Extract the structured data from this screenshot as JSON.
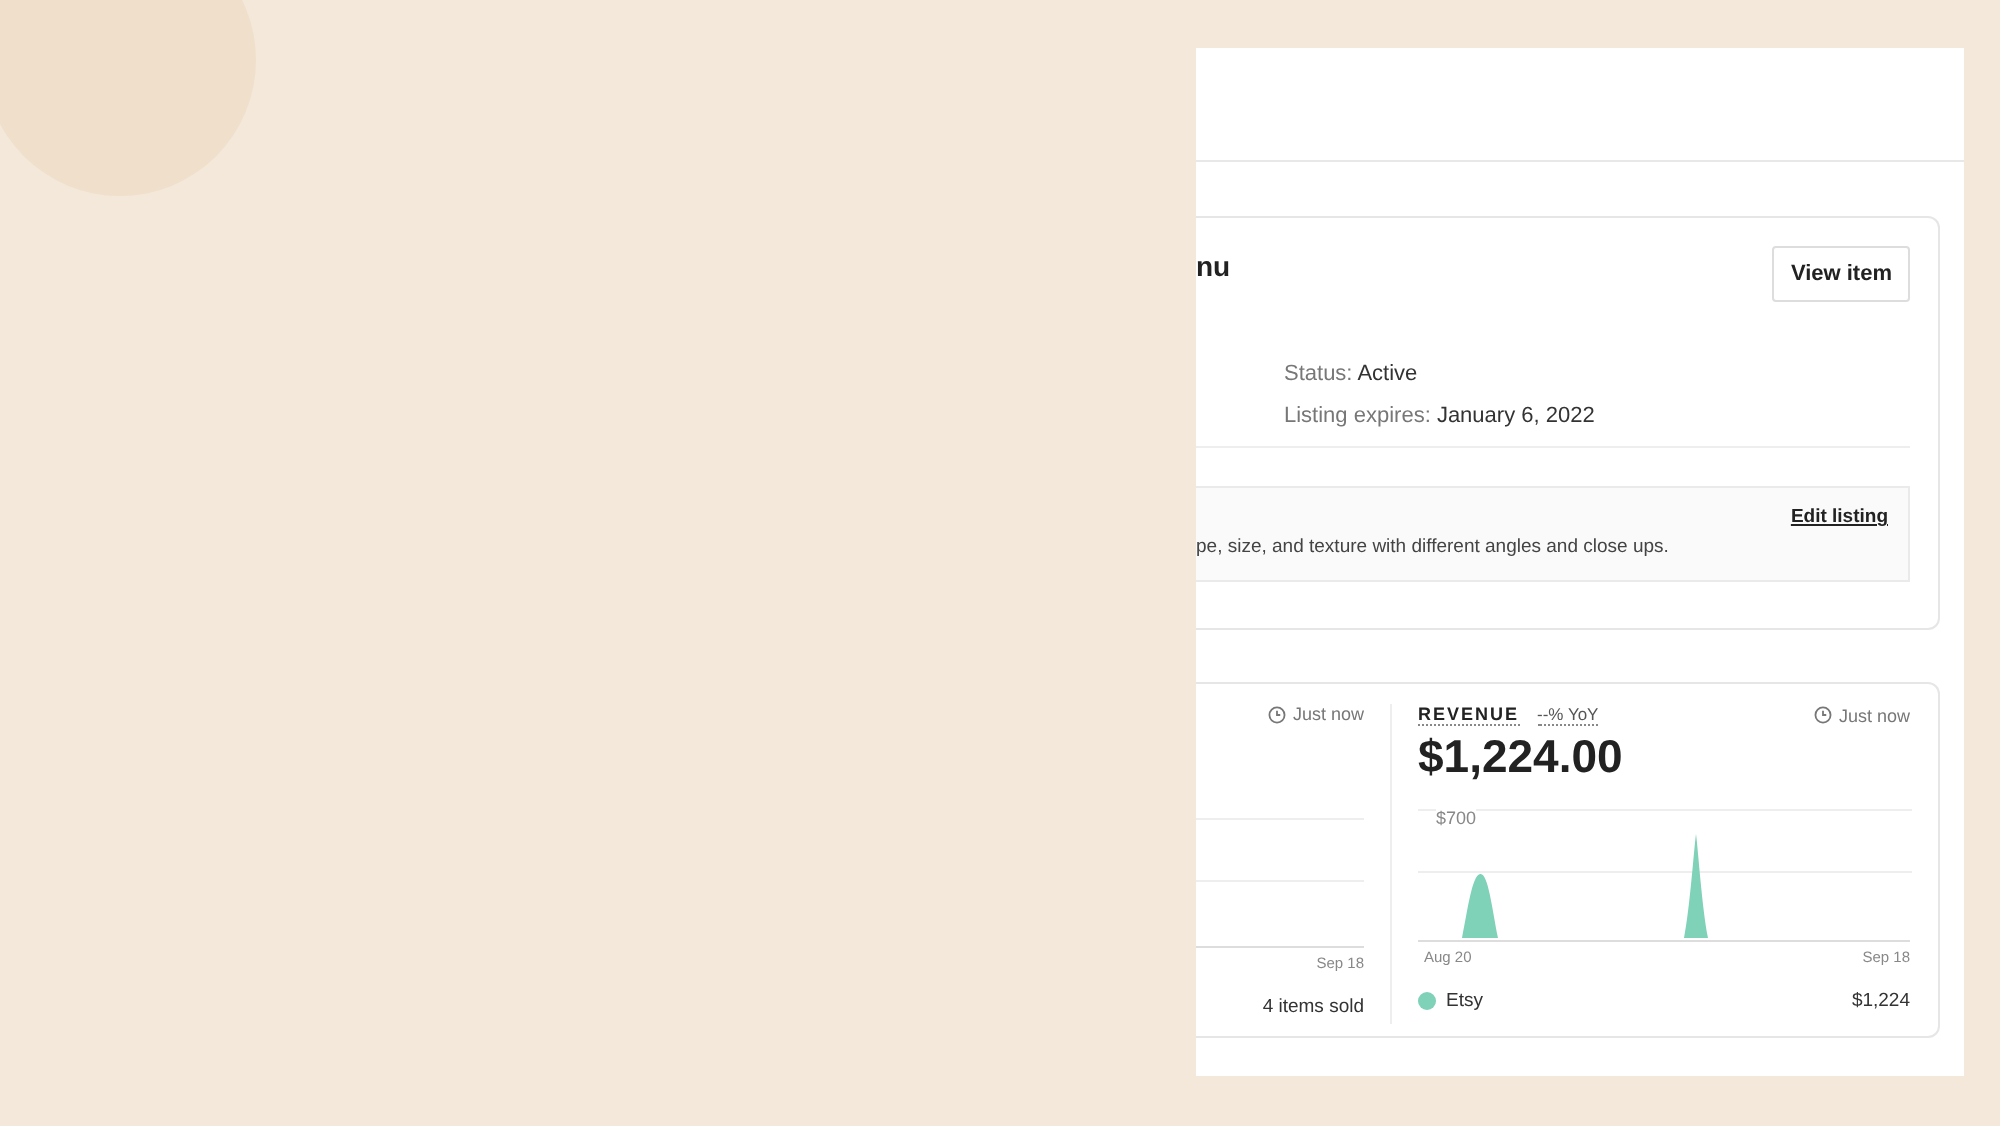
{
  "listing": {
    "title": "nu",
    "view_button": "View item",
    "details": [
      {
        "label": "Status:",
        "value": "Active"
      },
      {
        "label": "Listing expires:",
        "value": "January 6, 2022"
      }
    ],
    "tip": {
      "link": "Edit listing",
      "text": "pe, size, and texture with different angles and close ups."
    }
  },
  "orders": {
    "timestamp": "Just now",
    "x_end": "Sep 18",
    "summary": "4 items sold"
  },
  "revenue": {
    "title": "REVENUE",
    "yoy": "--% YoY",
    "timestamp": "Just now",
    "amount": "$1,224.00",
    "y_label": "$700",
    "x_start": "Aug 20",
    "x_end": "Sep 18",
    "legend": {
      "name": "Etsy",
      "value": "$1,224"
    }
  }
}
